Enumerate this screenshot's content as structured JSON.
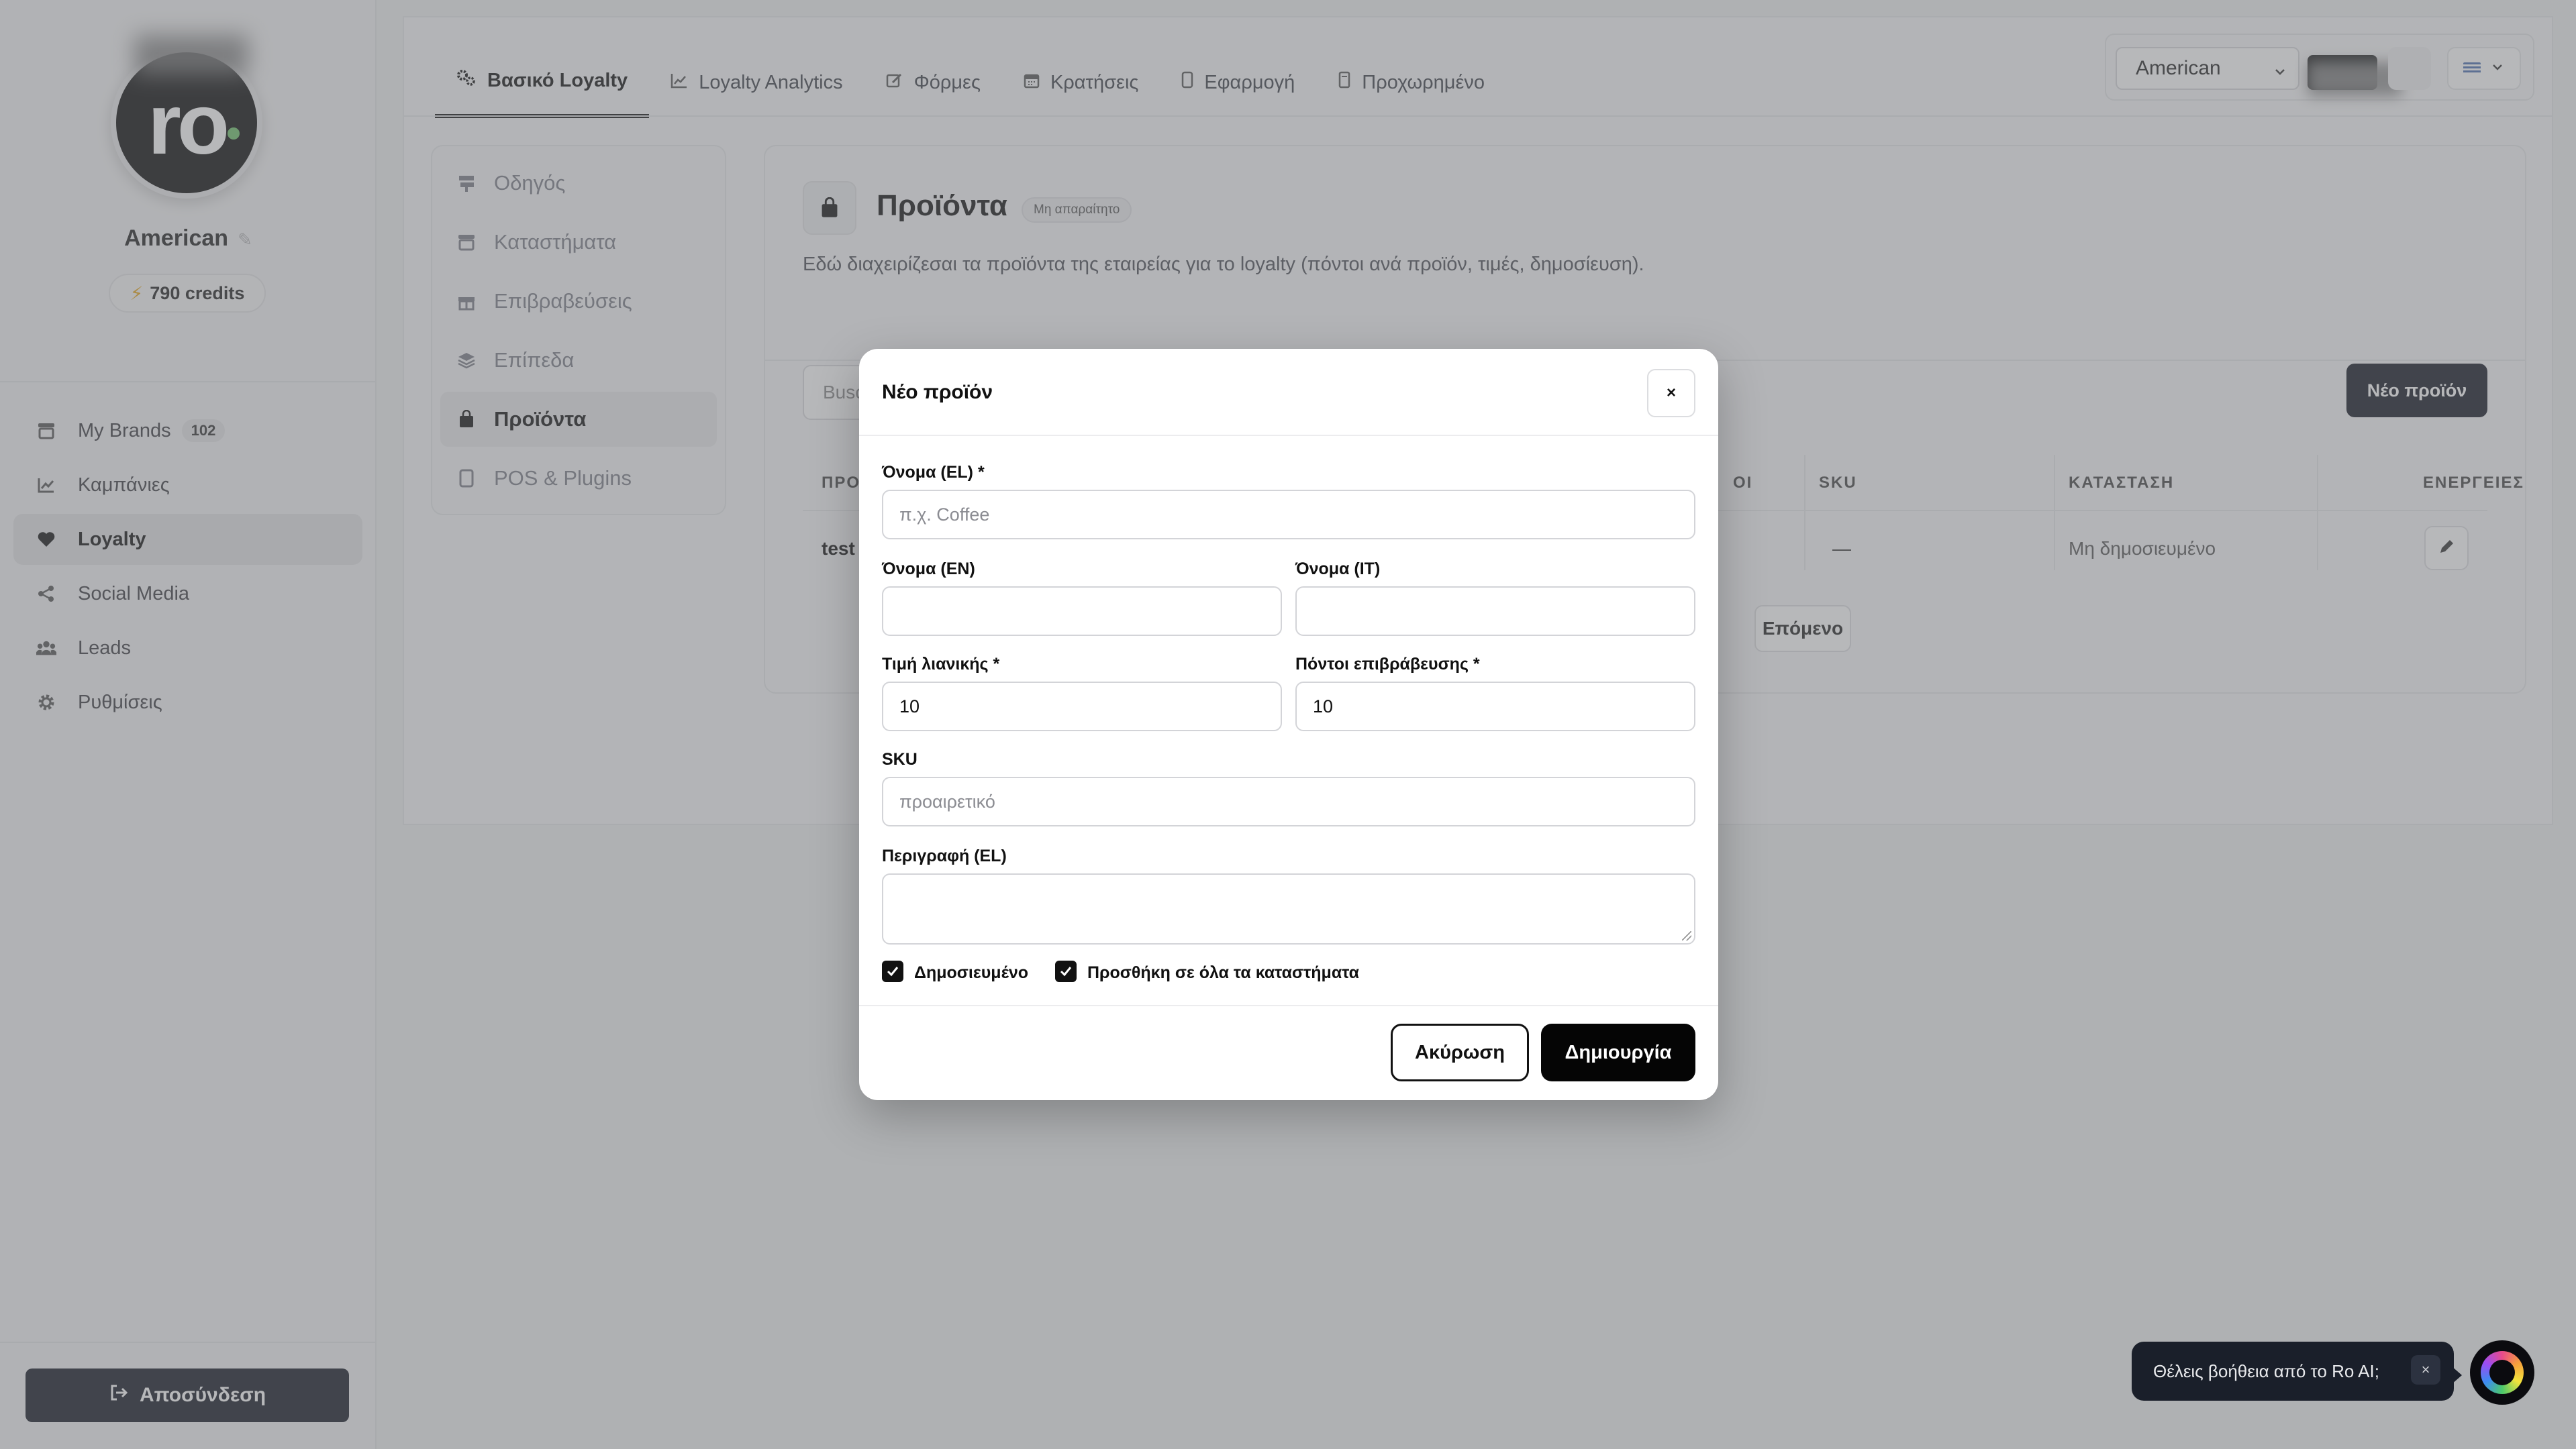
{
  "sidebar": {
    "avatar_text": "ro",
    "brand_name": "American",
    "credits": "790 credits",
    "nav": [
      {
        "label": "My Brands",
        "badge": "102",
        "icon": "store-icon"
      },
      {
        "label": "Καμπάνιες",
        "icon": "chart-line-icon"
      },
      {
        "label": "Loyalty",
        "icon": "heart-icon"
      },
      {
        "label": "Social Media",
        "icon": "share-icon"
      },
      {
        "label": "Leads",
        "icon": "users-icon"
      },
      {
        "label": "Ρυθμίσεις",
        "icon": "gear-icon"
      }
    ],
    "logout_label": "Αποσύνδεση"
  },
  "tabs": [
    {
      "label": "Βασικό Loyalty",
      "icon": "cogs-icon"
    },
    {
      "label": "Loyalty Analytics",
      "icon": "chart-icon"
    },
    {
      "label": "Φόρμες",
      "icon": "form-edit-icon"
    },
    {
      "label": "Κρατήσεις",
      "icon": "calendar-icon"
    },
    {
      "label": "Εφαρμογή",
      "icon": "mobile-icon"
    },
    {
      "label": "Προχωρημένο",
      "icon": "bookmark-icon"
    }
  ],
  "topbar": {
    "select_value": "American"
  },
  "subnav": [
    {
      "label": "Οδηγός",
      "icon": "signpost-icon"
    },
    {
      "label": "Καταστήματα",
      "icon": "store-icon"
    },
    {
      "label": "Επιβραβεύσεις",
      "icon": "gift-icon"
    },
    {
      "label": "Επίπεδα",
      "icon": "layers-icon"
    },
    {
      "label": "Προϊόντα",
      "icon": "bag-icon"
    },
    {
      "label": "POS & Plugins",
      "icon": "tablet-icon"
    }
  ],
  "content": {
    "title": "Προϊόντα",
    "badge": "Μη απαραίτητο",
    "description": "Εδώ διαχειρίζεσαι τα προϊόντα της εταιρείας για το loyalty (πόντοι ανά προϊόν, τιμές, δημοσίευση).",
    "search_placeholder": "Busc",
    "new_button": "Νέο προϊόν",
    "columns": {
      "name": "ΠΡΟ",
      "points": "ΟΙ",
      "sku": "SKU",
      "status": "ΚΑΤΑΣΤΑΣΗ",
      "actions": "ΕΝΕΡΓΕΙΕΣ"
    },
    "row": {
      "name": "test",
      "sku": "—",
      "status": "Μη δημοσιευμένο"
    },
    "next_button": "Επόμενο"
  },
  "modal": {
    "title": "Νέο προϊόν",
    "close": "×",
    "name_el_label": "Όνομα (EL) *",
    "name_el_placeholder": "π.χ. Coffee",
    "name_en_label": "Όνομα (EN)",
    "name_it_label": "Όνομα (IT)",
    "price_label": "Τιμή λιανικής *",
    "price_value": "10",
    "points_label": "Πόντοι επιβράβευσης *",
    "points_value": "10",
    "sku_label": "SKU",
    "sku_placeholder": "προαιρετικό",
    "desc_label": "Περιγραφή (EL)",
    "published_label": "Δημοσιευμένο",
    "all_stores_label": "Προσθήκη σε όλα τα καταστήματα",
    "cancel": "Ακύρωση",
    "create": "Δημιουργία"
  },
  "ai_helper": {
    "message": "Θέλεις βοήθεια από το Ro AI;",
    "close": "×"
  }
}
